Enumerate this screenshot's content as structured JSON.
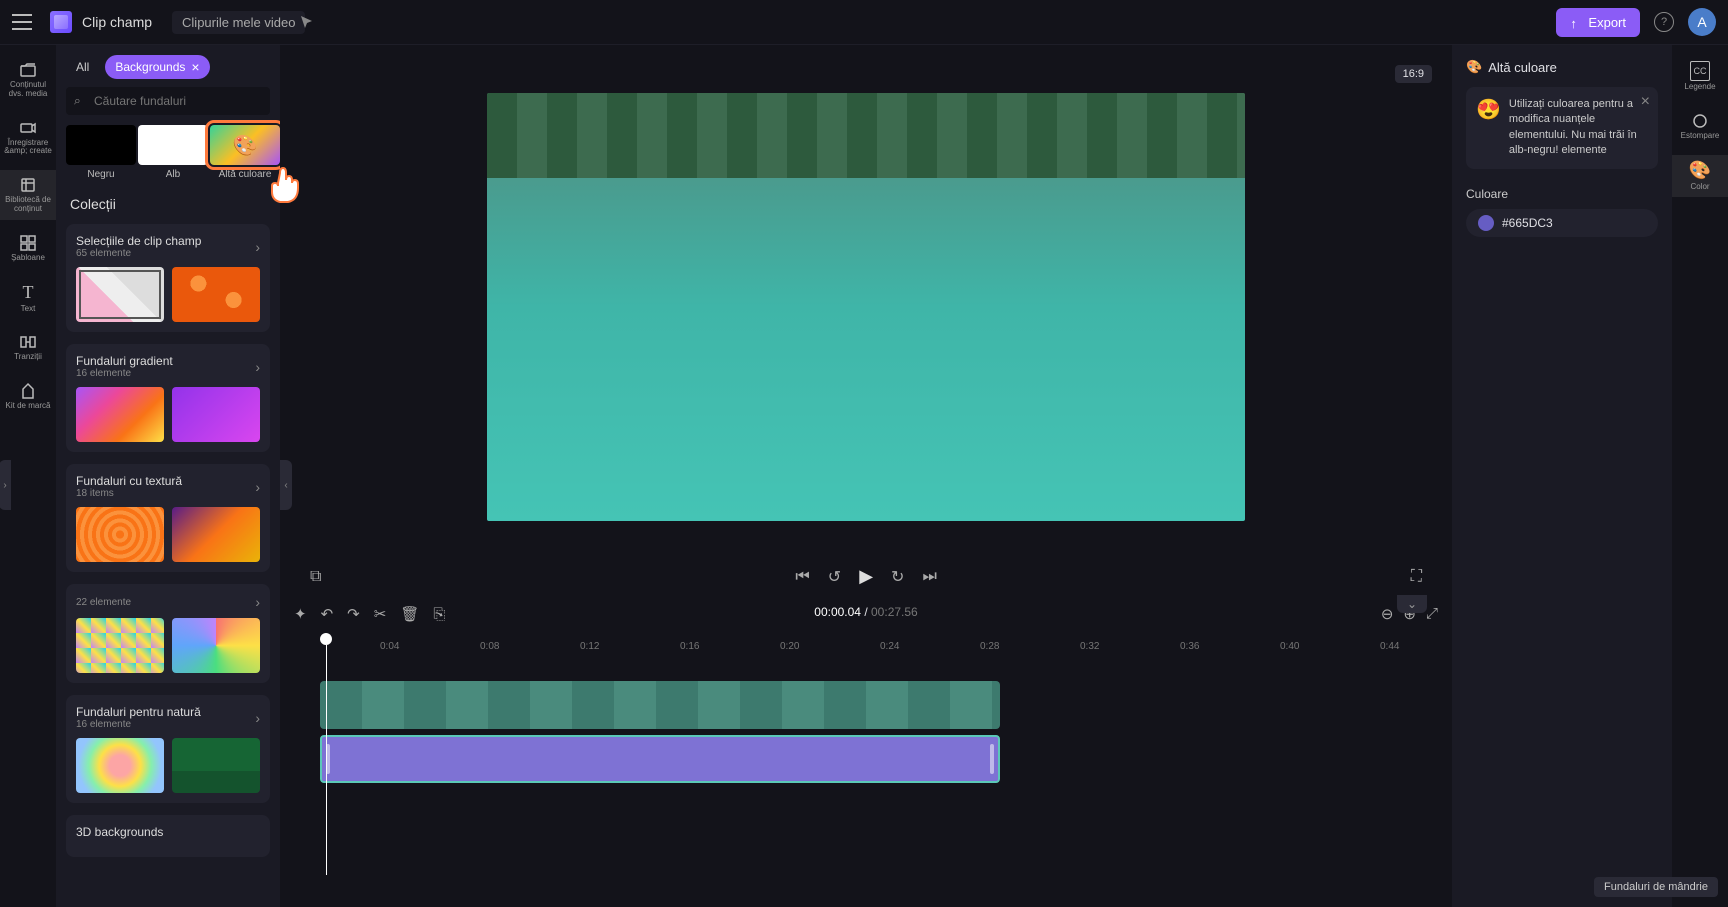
{
  "app": {
    "name": "Clip champ",
    "project": "Clipurile mele video"
  },
  "topbar": {
    "export": "Export",
    "avatar": "A"
  },
  "leftNav": [
    {
      "label": "Conținutul dvs. media",
      "icon": "folder"
    },
    {
      "label": "Înregistrare &amp; create",
      "icon": "camera"
    },
    {
      "label": "Bibliotecă de conținut",
      "icon": "library",
      "active": true
    },
    {
      "label": "Șabloane",
      "icon": "grid"
    },
    {
      "label": "Text",
      "icon": "text"
    },
    {
      "label": "Tranziții",
      "icon": "transition"
    },
    {
      "label": "Kit de marcă",
      "icon": "brand"
    }
  ],
  "tabs": {
    "all": "All",
    "active": "Backgrounds"
  },
  "search": {
    "placeholder": "Căutare fundaluri"
  },
  "colorTiles": [
    {
      "label": "Negru"
    },
    {
      "label": "Alb"
    },
    {
      "label": "Altă culoare"
    }
  ],
  "sectionCollections": "Colecții",
  "collections": [
    {
      "name": "Selecțiile de clip champ",
      "count": "65 elemente"
    },
    {
      "name": "Fundaluri gradient",
      "count": "16 elemente"
    },
    {
      "name": "Fundaluri cu textură",
      "count": "18 items"
    },
    {
      "name": "",
      "count": "22 elemente"
    },
    {
      "name": "Fundaluri pentru natură",
      "count": "16 elemente"
    },
    {
      "name": "3D backgrounds",
      "count": ""
    }
  ],
  "preview": {
    "ratio": "16:9"
  },
  "timeline": {
    "current": "00:00.04",
    "total": "00:27.56",
    "marks": [
      "0:04",
      "0:08",
      "0:12",
      "0:16",
      "0:20",
      "0:24",
      "0:28",
      "0:32",
      "0:36",
      "0:40",
      "0:44"
    ]
  },
  "rightPanel": {
    "title": "Altă culoare",
    "tip": "Utilizați culoarea pentru a modifica nuanțele elementului. Nu mai trăi în alb-negru! elemente",
    "colorLabel": "Culoare",
    "colorValue": "#665DC3"
  },
  "rightNav": [
    {
      "label": "Legende",
      "icon": "cc"
    },
    {
      "label": "Estompare",
      "icon": "blur"
    },
    {
      "label": "Color",
      "icon": "palette",
      "active": true
    }
  ],
  "footerTooltip": "Fundaluri de mândrie"
}
